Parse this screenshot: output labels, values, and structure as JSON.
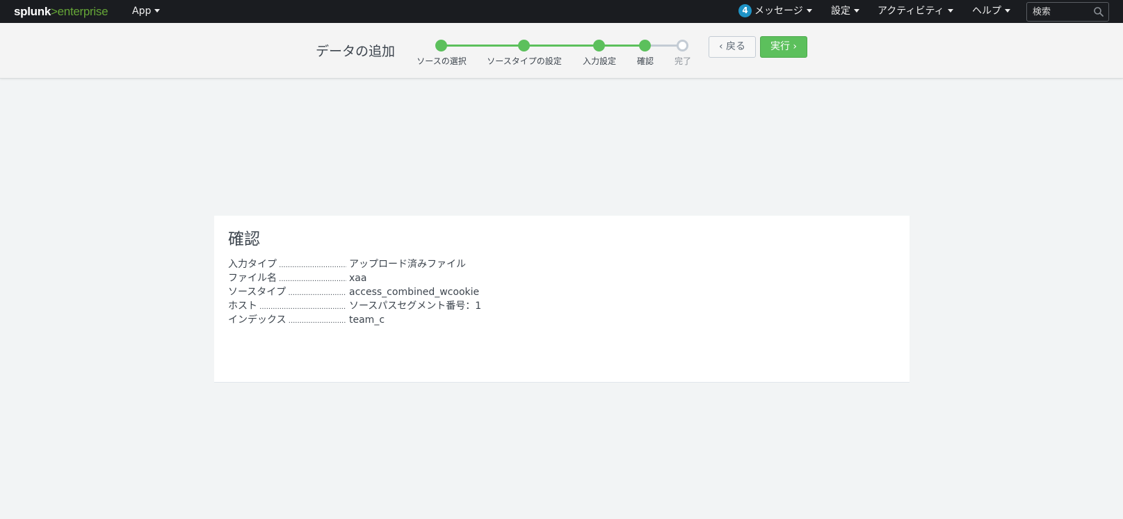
{
  "topbar": {
    "brand_main": "splunk",
    "brand_gt": ">",
    "brand_product": "enterprise",
    "app_menu": "App",
    "messages_count": "4",
    "messages_label": "メッセージ",
    "settings_label": "設定",
    "activity_label": "アクティビティ",
    "help_label": "ヘルプ",
    "search_placeholder": "検索"
  },
  "wizard": {
    "title": "データの追加",
    "steps": [
      {
        "label": "ソースの選択",
        "status": "done"
      },
      {
        "label": "ソースタイプの設定",
        "status": "done"
      },
      {
        "label": "入力設定",
        "status": "done"
      },
      {
        "label": "確認",
        "status": "done"
      },
      {
        "label": "完了",
        "status": "todo"
      }
    ],
    "back_label": "戻る",
    "run_label": "実行"
  },
  "review": {
    "title": "確認",
    "rows": [
      {
        "label": "入力タイプ",
        "value": "アップロード済みファイル"
      },
      {
        "label": "ファイル名",
        "value": "xaa"
      },
      {
        "label": "ソースタイプ",
        "value": "access_combined_wcookie"
      },
      {
        "label": "ホスト",
        "value": "ソースパスセグメント番号：1"
      },
      {
        "label": "インデックス",
        "value": "team_c"
      }
    ]
  },
  "colors": {
    "topbar_bg": "#1a1c20",
    "brand_accent": "#65a637",
    "step_done": "#5cc05c",
    "step_todo": "#c3cbd4",
    "run_button": "#5cc05c",
    "badge": "#1e93c6"
  }
}
